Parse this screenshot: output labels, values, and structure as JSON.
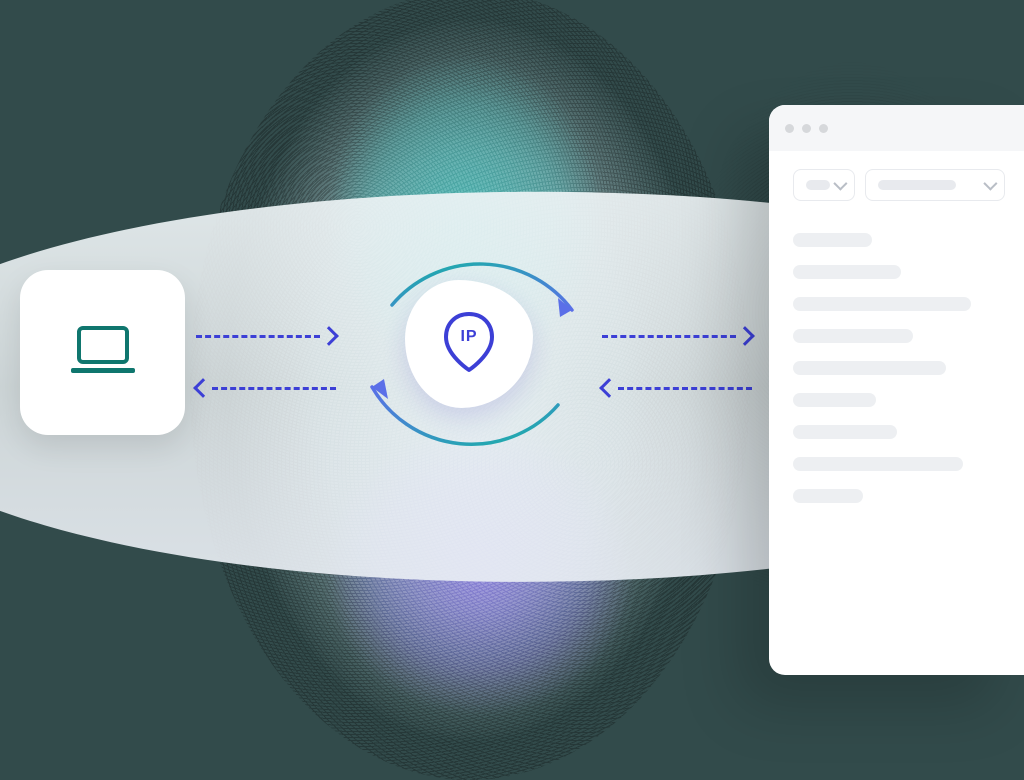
{
  "diagram": {
    "ip_badge_label": "IP",
    "colors": {
      "accent_blue": "#3c3fd6",
      "teal": "#0f766e",
      "gradient_teal": "#17b3a4",
      "gradient_blue": "#5b6fe8"
    },
    "nodes": {
      "client": "laptop",
      "proxy": "rotating-ip",
      "target": "browser-window"
    },
    "flows": [
      {
        "from": "client",
        "to": "proxy",
        "dir": "right"
      },
      {
        "from": "proxy",
        "to": "client",
        "dir": "left"
      },
      {
        "from": "proxy",
        "to": "target",
        "dir": "right"
      },
      {
        "from": "target",
        "to": "proxy",
        "dir": "left"
      }
    ],
    "browser_skeleton_line_widths_pct": [
      38,
      52,
      86,
      58,
      74,
      40,
      50,
      82,
      34
    ]
  }
}
